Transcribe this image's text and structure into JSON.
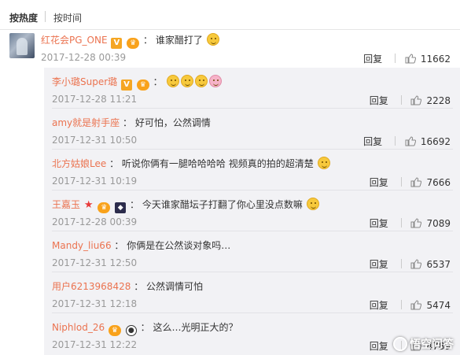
{
  "sort": {
    "hot": "按热度",
    "time": "按时间"
  },
  "top_comment": {
    "user": "红花会PG_ONE",
    "text": "谁家醋打了",
    "time": "2017-12-28 00:39",
    "reply_label": "回复",
    "likes": "11662"
  },
  "replies": [
    {
      "user": "李小璐Super璐",
      "text": "",
      "time": "2017-12-28 11:21",
      "reply_label": "回复",
      "likes": "2228"
    },
    {
      "user": "amy就是射手座",
      "text": "好可怕，公然调情",
      "time": "2017-12-31 10:50",
      "reply_label": "回复",
      "likes": "16692"
    },
    {
      "user": "北方姑娘Lee",
      "text": "听说你俩有一腿哈哈哈哈 视频真的拍的超清楚",
      "time": "2017-12-31 10:19",
      "reply_label": "回复",
      "likes": "7666"
    },
    {
      "user": "王嘉玉",
      "text": "今天谁家醋坛子打翻了你心里没点数嘛",
      "time": "2017-12-28 00:39",
      "reply_label": "回复",
      "likes": "7089"
    },
    {
      "user": "Mandy_liu66",
      "text": "你俩是在公然谈对象吗…",
      "time": "2017-12-31 12:50",
      "reply_label": "回复",
      "likes": "6537"
    },
    {
      "user": "用户6213968428",
      "text": "公然调情可怕",
      "time": "2017-12-31 12:18",
      "reply_label": "回复",
      "likes": "5474"
    },
    {
      "user": "Niphlod_26",
      "text": "这么…光明正大的？",
      "time": "2017-12-31 12:22",
      "reply_label": "回复",
      "likes": "4789"
    }
  ],
  "watermark": "悟空问答",
  "colors": {
    "username": "#eb7350",
    "reply_bg": "#f2f2f5",
    "meta": "#999999"
  }
}
